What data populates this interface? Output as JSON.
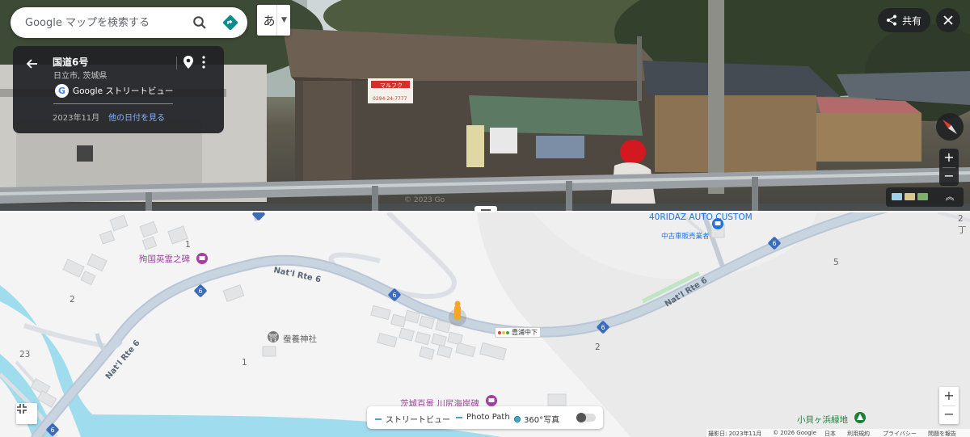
{
  "search": {
    "placeholder": "Google マップを検索する"
  },
  "ime": {
    "char": "あ"
  },
  "info_card": {
    "title": "国道6号",
    "subtitle": "日立市, 茨城県",
    "brand": "Google ストリートビュー",
    "date": "2023年11月",
    "other_dates_link": "他の日付を見る"
  },
  "share": {
    "label": "共有"
  },
  "pano_watermark": "© 2023 Go",
  "pano_signs": {
    "shop": "マルフク",
    "phone": "0294-24-7777"
  },
  "map": {
    "road_labels": [
      "Nat'l Rte 6",
      "Nat'l Rte 6",
      "Nat'l Rte 6"
    ],
    "route_shield": "6",
    "numbers": [
      "1",
      "2",
      "23",
      "1",
      "2",
      "5",
      "2丁"
    ],
    "poi": {
      "memorial": "殉国英霊之碑",
      "shrine": "蚕養神社",
      "monument": "茨城百景 川尻海岸碑",
      "auto_shop": "40RIDAZ AUTO CUSTOM",
      "auto_shop_type": "中古車販売業者",
      "park": "小貝ヶ浜緑地",
      "bus_stop": "豊浦中下"
    }
  },
  "legend": {
    "street_view": "ストリートビュー",
    "photo_path": "Photo Path",
    "photo_360": "360°写真"
  },
  "footer": {
    "capture_date": "撮影日: 2023年11月",
    "copyright": "© 2026 Google",
    "country": "日本",
    "terms": "利用規約",
    "privacy": "プライバシー",
    "report": "問題を報告"
  },
  "colors": {
    "road": "#b9c6d6",
    "water": "#9fdcee",
    "poi_purple": "#a142a1",
    "link_blue": "#8ab4f8",
    "accent_blue": "#1a73e8"
  }
}
